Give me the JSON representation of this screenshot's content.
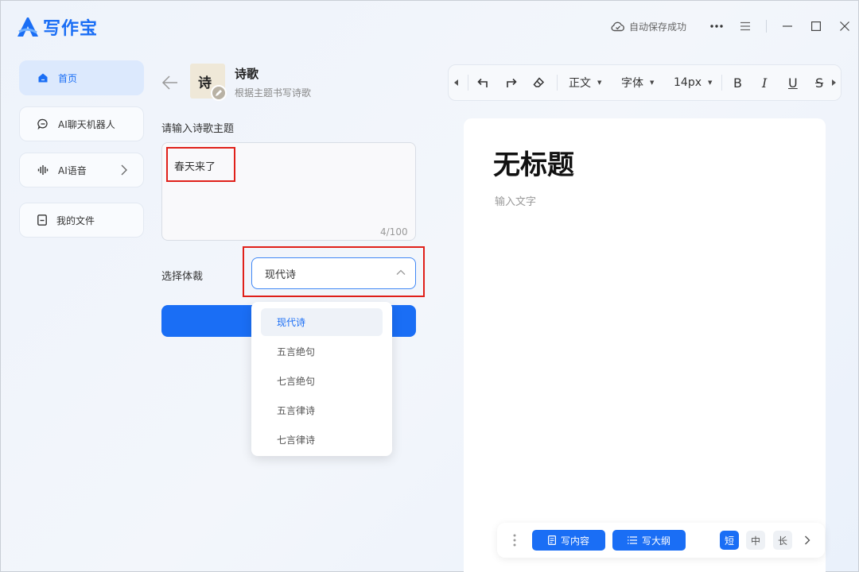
{
  "app": {
    "name": "写作宝",
    "brand_color": "#1a6ef5"
  },
  "titlebar": {
    "save_status": "自动保存成功"
  },
  "sidebar": {
    "items": [
      {
        "label": "首页",
        "icon": "home-icon",
        "active": true
      },
      {
        "label": "AI聊天机器人",
        "icon": "chat-icon"
      },
      {
        "label": "AI语音",
        "icon": "voice-wave-icon"
      },
      {
        "label": "我的文件",
        "icon": "file-icon"
      }
    ]
  },
  "panel": {
    "title": "诗歌",
    "subtitle": "根据主题书写诗歌",
    "thumb_char": "诗",
    "topic_label": "请输入诗歌主题",
    "topic_value": "春天来了",
    "topic_counter": "4/100",
    "genre_label": "选择体裁",
    "genre_value": "现代诗",
    "genre_options": [
      "现代诗",
      "五言绝句",
      "七言绝句",
      "五言律诗",
      "七言律诗"
    ]
  },
  "toolbar": {
    "paragraph_style": "正文",
    "font": "字体",
    "font_size": "14px",
    "bold": "B",
    "italic": "I",
    "underline": "U",
    "strike": "S"
  },
  "editor": {
    "title": "无标题",
    "placeholder": "输入文字"
  },
  "bottom_bar": {
    "write_content": "写内容",
    "write_outline": "写大纲",
    "length_short": "短",
    "length_medium": "中",
    "length_long": "长"
  },
  "highlight_color": "#e0201a"
}
